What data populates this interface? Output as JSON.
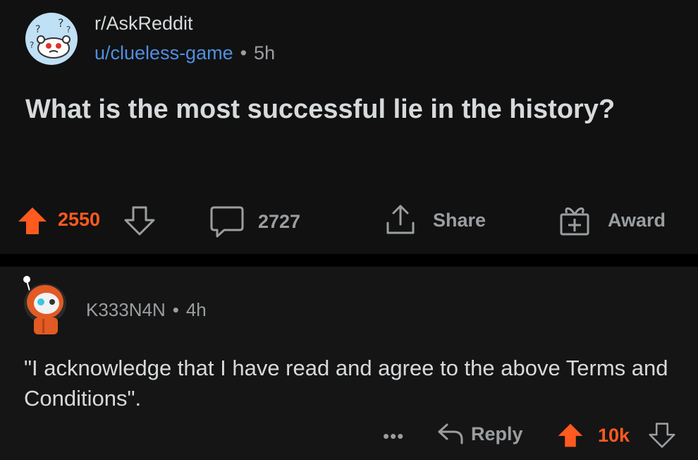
{
  "post": {
    "subreddit": "r/AskReddit",
    "author": "u/clueless-game",
    "time": "5h",
    "dot": "•",
    "title": "What is the most successful lie in the history?",
    "upvotes": "2550",
    "comments": "2727",
    "share_label": "Share",
    "award_label": "Award"
  },
  "comment": {
    "username": "K333N4N",
    "dot": "•",
    "time": "4h",
    "body": "\"I acknowledge that I have read and agree to the above Terms and Conditions\".",
    "more_label": "•••",
    "reply_label": "Reply",
    "upvotes": "10k"
  },
  "colors": {
    "upvote_accent": "#ff5a1f",
    "link_blue": "#4f8fe0",
    "muted_text": "#9b9ea1",
    "primary_text": "#d7dadc",
    "post_bg": "#111111",
    "comment_bg": "#151515"
  },
  "icons": [
    "snoo-confused-avatar",
    "upvote-icon",
    "downvote-icon",
    "comment-icon",
    "share-icon",
    "award-icon",
    "reply-icon",
    "user-avatar"
  ]
}
